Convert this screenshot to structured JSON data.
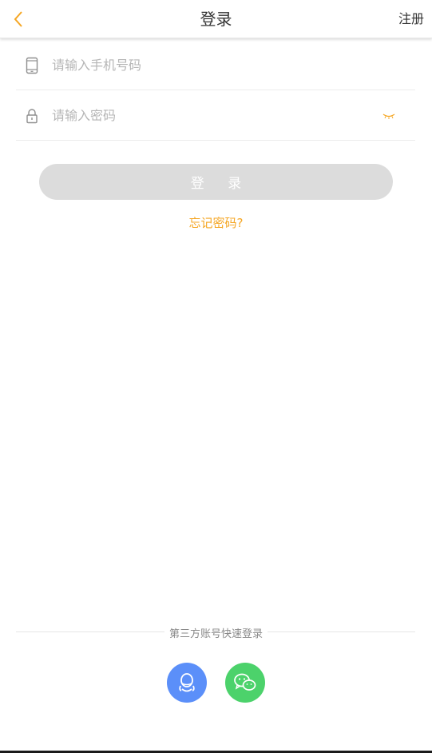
{
  "navbar": {
    "title": "登录",
    "register_label": "注册"
  },
  "form": {
    "phone": {
      "value": "",
      "placeholder": "请输入手机号码"
    },
    "password": {
      "value": "",
      "placeholder": "请输入密码"
    }
  },
  "login_button_label": "登 录",
  "forgot_password_label": "忘记密码?",
  "third_party": {
    "label": "第三方账号快速登录",
    "providers": [
      {
        "name": "qq-icon",
        "color": "#5b8ff9"
      },
      {
        "name": "wechat-icon",
        "color": "#4cd26b"
      }
    ]
  },
  "colors": {
    "accent": "#f5a623",
    "button_disabled": "#dcdcdc"
  }
}
